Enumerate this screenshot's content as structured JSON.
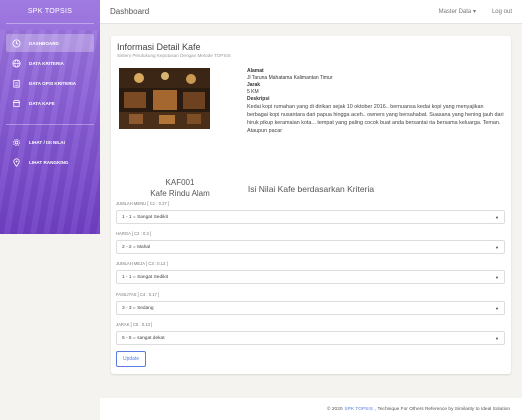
{
  "sidebar": {
    "brand": "SPK TOPSIS",
    "items": [
      {
        "label": "DASHBOARD",
        "icon": "clock-icon",
        "active": true
      },
      {
        "label": "DATA KRITERIA",
        "icon": "globe-icon",
        "active": false
      },
      {
        "label": "DATA OPSI KRITERIA",
        "icon": "clipboard-icon",
        "active": false
      },
      {
        "label": "DATA KAFE",
        "icon": "store-icon",
        "active": false
      },
      {
        "label": "LIHAT / ISI NILAI",
        "icon": "gear-icon",
        "active": false
      },
      {
        "label": "LIHAT RANGKING",
        "icon": "map-pin-icon",
        "active": false
      }
    ]
  },
  "topbar": {
    "title": "Dashboard",
    "master_data": "Master Data",
    "logout": "Log out"
  },
  "card": {
    "title": "Informasi Detail Kafe",
    "subtitle": "Sistem Pendukung Keputusan Dengan Metode TOPSIS",
    "cafe_code": "KAF001",
    "cafe_name": "Kafe Rindu Alam",
    "alamat_label": "Alamat",
    "alamat": "Jl Taruna Mahatama Kalimantan Timur",
    "jarak_label": "Jarak",
    "jarak": "5 KM",
    "deskripsi_label": "Deskripsi",
    "deskripsi": "Kedai kopi rumahan yang di dirikan sejak 10 oktober 2016.. bernuansa kedai kopi yang menyajikan berbagai kopi nusantara dari papua hingga aceh.. owners yang bersahabat. Suasana yang hening jauh dari hiruk pikup keramaian kota... tempat yang paling cocok buat anda bersantai ria bersama keluarga. Teman. Ataupun pacar"
  },
  "criteria": {
    "title": "Isi Nilai Kafe berdasarkan Kriteria",
    "fields": [
      {
        "label": "JUMLAH MENU [ C1 : 0.27 ]",
        "value": "1 - 1 = Sangat Sedikit"
      },
      {
        "label": "HARGA [ C2 : 0.3 ]",
        "value": "2 - 2 = Mahal"
      },
      {
        "label": "JUMLAH MEJA [ C3 : 0.13 ]",
        "value": "1 - 1 = Sangat Sedikit"
      },
      {
        "label": "FASILITAS [ C4 : 0.17 ]",
        "value": "3 - 3 = Sedang"
      },
      {
        "label": "JARAK [ C5 : 0.13 ]",
        "value": "5 - 5 = sangat dekat"
      }
    ],
    "update_label": "Update"
  },
  "footer": {
    "prefix": "© 2020",
    "link": "SPK TOPSIS",
    "suffix": ", Technique For Others Reference by Similarity to Ideal Solution"
  }
}
